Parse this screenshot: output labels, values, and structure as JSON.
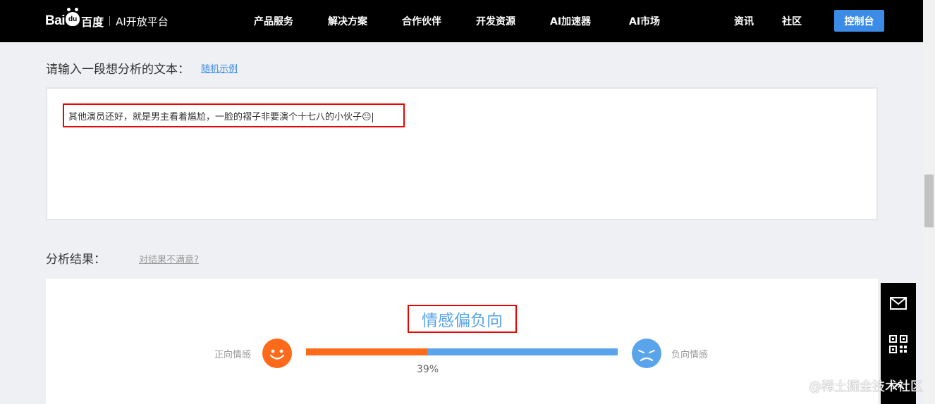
{
  "header": {
    "logo": {
      "bai": "Bai",
      "du": "du",
      "baidu_cn": "百度",
      "platform": "AI开放平台"
    },
    "nav": [
      {
        "label": "产品服务"
      },
      {
        "label": "解决方案"
      },
      {
        "label": "合作伙伴"
      },
      {
        "label": "开发资源"
      },
      {
        "label": "AI加速器"
      },
      {
        "label": "AI市场"
      },
      {
        "label": "资讯"
      },
      {
        "label": "社区"
      }
    ],
    "console_button": "控制台"
  },
  "input_section": {
    "title": "请输入一段想分析的文本：",
    "random_example_link": "随机示例",
    "text": "其他演员还好，就是男主看着尴尬，一脸的褶子非要演个十七八的小伙子😐"
  },
  "result_section": {
    "title": "分析结果：",
    "unsatisfied_link": "对结果不满意?",
    "sentiment": "情感偏负向",
    "positive_label": "正向情感",
    "negative_label": "负向情感",
    "positive_percent_text": "39%",
    "positive_fraction": 0.39
  },
  "sidebar": {
    "icons": [
      "mail-icon",
      "qr-code-icon",
      "back-to-top-icon"
    ]
  },
  "watermark": "@稀土掘金技术社区",
  "colors": {
    "accent": "#3c8ce7",
    "positive": "#ff6a1a",
    "negative": "#5aa4ec",
    "highlight": "#ee0000"
  }
}
